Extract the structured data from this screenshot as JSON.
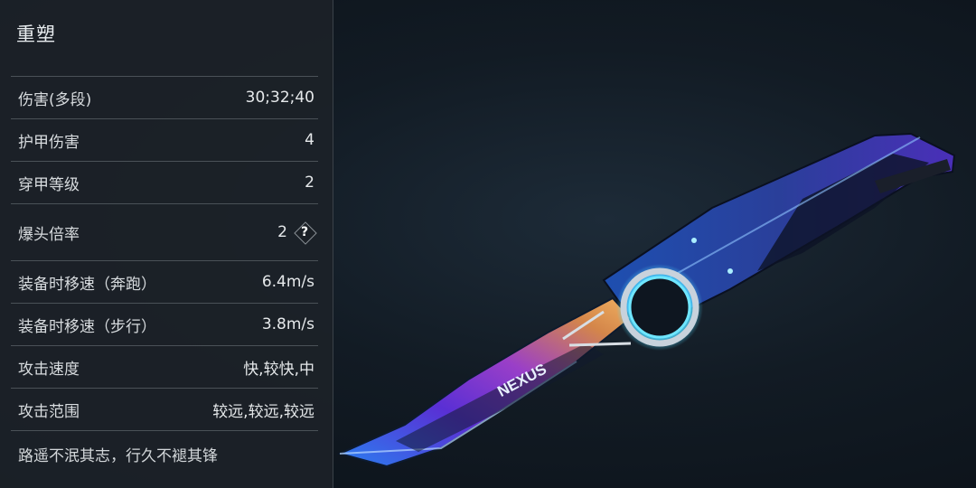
{
  "panel": {
    "title": "重塑",
    "stats": [
      {
        "label": "伤害(多段)",
        "value": "30;32;40"
      },
      {
        "label": "护甲伤害",
        "value": "4"
      },
      {
        "label": "穿甲等级",
        "value": "2"
      },
      {
        "label": "爆头倍率",
        "value": "2"
      },
      {
        "label": "装备时移速（奔跑）",
        "value": "6.4m/s"
      },
      {
        "label": "装备时移速（步行）",
        "value": "3.8m/s"
      },
      {
        "label": "攻击速度",
        "value": "快,较快,中"
      },
      {
        "label": "攻击范围",
        "value": "较远,较远,较远"
      }
    ],
    "help_icon_text": "?",
    "motto": "路遥不泯其志，行久不褪其锋"
  },
  "weapon": {
    "brand_text": "NEXUS",
    "icon": "knife-weapon-render"
  },
  "colors": {
    "panel_bg": "#1c2228",
    "divider": "#4a5157",
    "accent_blue": "#2c6bd8",
    "accent_purple": "#6a2bd6"
  }
}
